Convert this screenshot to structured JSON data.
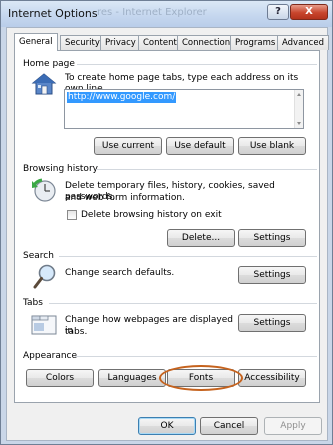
{
  "window": {
    "title": "Internet Options",
    "background_title_ghost": "res - Internet Explorer",
    "help_label": "?",
    "close_label": "X"
  },
  "tabs": [
    {
      "label": "General",
      "active": true
    },
    {
      "label": "Security"
    },
    {
      "label": "Privacy"
    },
    {
      "label": "Content"
    },
    {
      "label": "Connections"
    },
    {
      "label": "Programs"
    },
    {
      "label": "Advanced"
    }
  ],
  "home_page": {
    "section_title": "Home page",
    "description": "To create home page tabs, type each address on its own line.",
    "url_value": "http://www.google.com/",
    "buttons": {
      "use_current": "Use current",
      "use_default": "Use default",
      "use_blank": "Use blank"
    }
  },
  "browsing_history": {
    "section_title": "Browsing history",
    "description_line1": "Delete temporary files, history, cookies, saved passwords,",
    "description_line2": "and web form information.",
    "checkbox_label": "Delete browsing history on exit",
    "checkbox_checked": false,
    "buttons": {
      "delete": "Delete...",
      "settings": "Settings"
    }
  },
  "search": {
    "section_title": "Search",
    "description": "Change search defaults.",
    "settings_button": "Settings"
  },
  "tabs_section": {
    "section_title": "Tabs",
    "description_line1": "Change how webpages are displayed in",
    "description_line2": "tabs.",
    "settings_button": "Settings"
  },
  "appearance": {
    "section_title": "Appearance",
    "buttons": {
      "colors": "Colors",
      "languages": "Languages",
      "fonts": "Fonts",
      "accessibility": "Accessibility"
    },
    "highlight_color": "#c5621d"
  },
  "footer": {
    "ok": "OK",
    "cancel": "Cancel",
    "apply": "Apply",
    "apply_enabled": false
  },
  "colors": {
    "accent_blue": "#3399ff",
    "title_bar": "#c4d6ee",
    "close_red": "#c8452d"
  }
}
